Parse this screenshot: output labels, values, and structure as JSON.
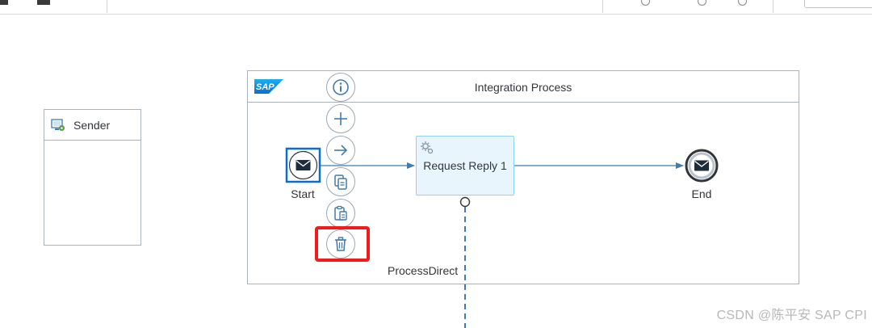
{
  "sender": {
    "label": "Sender"
  },
  "integration_process": {
    "title": "Integration Process",
    "logo_text": "SAP"
  },
  "start_event": {
    "label": "Start"
  },
  "end_event": {
    "label": "End"
  },
  "task": {
    "label": "Request Reply 1"
  },
  "adapter_label": "ProcessDirect",
  "context_menu": [
    {
      "name": "info-icon"
    },
    {
      "name": "add-icon"
    },
    {
      "name": "connect-arrow-icon"
    },
    {
      "name": "copy-icon"
    },
    {
      "name": "paste-icon"
    },
    {
      "name": "delete-icon",
      "highlighted": true
    }
  ],
  "colors": {
    "accent": "#427cac",
    "pool_border": "#a9b4be",
    "task_fill": "#e8f5fd",
    "task_border": "#8fd2f2",
    "highlight": "#f21b1b",
    "start_border": "#0a6ed1"
  },
  "watermark": "CSDN @陈平安 SAP CPI"
}
